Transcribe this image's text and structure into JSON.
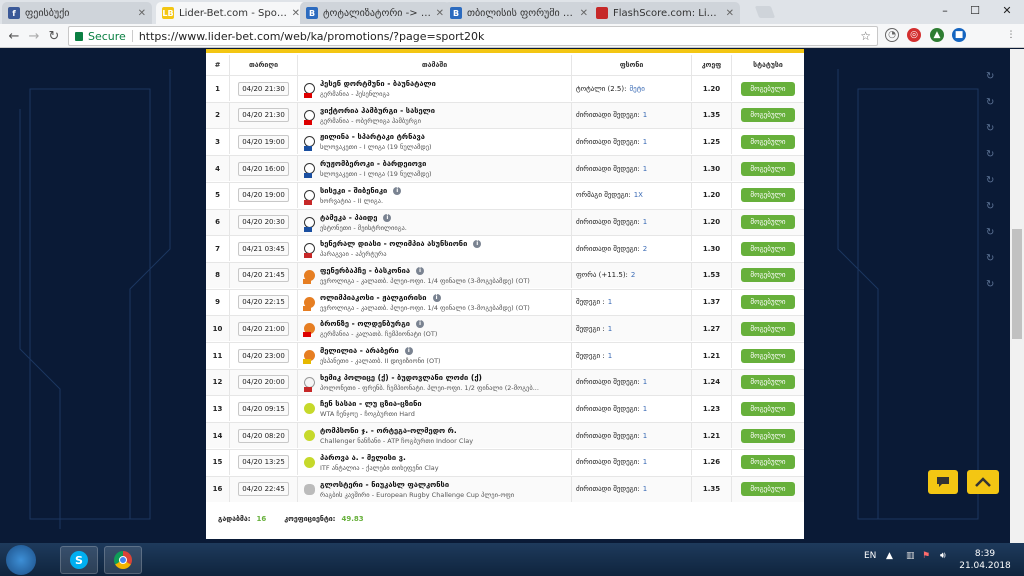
{
  "browser": {
    "tabs": [
      {
        "title": "ფეისბუქი",
        "favicon_color": "#3b5998",
        "favicon_char": "f",
        "active": false
      },
      {
        "title": "Lider-Bet.com - Sports a",
        "favicon_color": "#f3c613",
        "favicon_char": "LB",
        "active": true
      },
      {
        "title": "ტოტალიზატორი -> თბ",
        "favicon_color": "#2c6bbf",
        "favicon_char": "B",
        "active": false
      },
      {
        "title": "თბილისის ფორუმი - Pr",
        "favicon_color": "#2c6bbf",
        "favicon_char": "B",
        "active": false
      },
      {
        "title": "FlashScore.com: Live Foo",
        "favicon_color": "#c62828",
        "favicon_char": "",
        "active": false
      }
    ],
    "secure_label": "Secure",
    "url": "https://www.lider-bet.com/web/ka/promotions/?page=sport20k"
  },
  "table": {
    "headers": [
      "#",
      "თარიღი",
      "თამაში",
      "ფსონი",
      "კოეფ",
      "სტატუსი"
    ],
    "rows": [
      {
        "num": "1",
        "date": "04/20 21:30",
        "match": "ჰესენ დორტმუნი - ბაუნატალი",
        "league": "გერმანია - ჰესენლიგა",
        "bet": "ტოტალი (2.5):",
        "sel": "მეტი",
        "coef": "1.20",
        "status": "მოგებული",
        "icon": "ball",
        "flag": "#d00",
        "info": false
      },
      {
        "num": "2",
        "date": "04/20 21:30",
        "match": "ვიქტორია ჰამბურგი - სასელი",
        "league": "გერმანია - ობერლიგა ჰამბურგი",
        "bet": "ძირითადი შედეგი:",
        "sel": "1",
        "coef": "1.35",
        "status": "მოგებული",
        "icon": "ball",
        "flag": "#d00",
        "info": false
      },
      {
        "num": "3",
        "date": "04/20 19:00",
        "match": "ჟილინა - სპარტაკი ტრნავა",
        "league": "სლოვაკეთი - I ლიგა (19 ნულამდე)",
        "bet": "ძირითადი შედეგი:",
        "sel": "1",
        "coef": "1.25",
        "status": "მოგებული",
        "icon": "ball",
        "flag": "#1a4fa0",
        "info": false
      },
      {
        "num": "4",
        "date": "04/20 16:00",
        "match": "რუჟომბეროკი - ბარდეიოვი",
        "league": "სლოვაკეთი - I ლიგა (19 ნულამდე)",
        "bet": "ძირითადი შედეგი:",
        "sel": "1",
        "coef": "1.30",
        "status": "მოგებული",
        "icon": "ball",
        "flag": "#1a4fa0",
        "info": false
      },
      {
        "num": "5",
        "date": "04/20 19:00",
        "match": "სისეკი - შიბენიკი",
        "league": "ხორვატია - II ლიგა.",
        "bet": "ორმაგი შედეგი:",
        "sel": "1X",
        "coef": "1.20",
        "status": "მოგებული",
        "icon": "ball",
        "flag": "#c62828",
        "info": true
      },
      {
        "num": "6",
        "date": "04/20 20:30",
        "match": "ტამეკა - პაიდე",
        "league": "ესტონეთი - მეისტრილიიგა.",
        "bet": "ძირითადი შედეგი:",
        "sel": "1",
        "coef": "1.20",
        "status": "მოგებული",
        "icon": "ball",
        "flag": "#1a4fa0",
        "info": true
      },
      {
        "num": "7",
        "date": "04/21 03:45",
        "match": "ხენერალ დიასი - ოლიმპია ასუნსიონი",
        "league": "პარაგვაი - აპერტურა",
        "bet": "ძირითადი შედეგი:",
        "sel": "2",
        "coef": "1.30",
        "status": "მოგებული",
        "icon": "ball",
        "flag": "#c62828",
        "info": true
      },
      {
        "num": "8",
        "date": "04/20 21:45",
        "match": "ფენერბაჰჩე - ბასკონია",
        "league": "ევროლიგა - კალათბ. პლეი-ოფი. 1/4 ფინალი (3-მოგებამდე) (OT)",
        "bet": "ფორა (+11.5):",
        "sel": "2",
        "coef": "1.53",
        "status": "მოგებული",
        "icon": "basket",
        "flag": "#e67e22",
        "info": true
      },
      {
        "num": "9",
        "date": "04/20 22:15",
        "match": "ოლიმპიაკოსი - ჟალგირისი",
        "league": "ევროლიგა - კალათბ. პლეი-ოფი. 1/4 ფინალი (3-მოგებამდე) (OT)",
        "bet": "შედეგი :",
        "sel": "1",
        "coef": "1.37",
        "status": "მოგებული",
        "icon": "basket",
        "flag": "#e67e22",
        "info": true
      },
      {
        "num": "10",
        "date": "04/20 21:00",
        "match": "ბრონზე - ოლდენბურგი",
        "league": "გერმანია - კალათბ. ჩემპიონატი (OT)",
        "bet": "შედეგი :",
        "sel": "1",
        "coef": "1.27",
        "status": "მოგებული",
        "icon": "basket",
        "flag": "#d00",
        "info": true
      },
      {
        "num": "11",
        "date": "04/20 23:00",
        "match": "მელილია - არაბერი",
        "league": "ესპანეთი - კალათბ. II დივიზიონი (OT)",
        "bet": "შედეგი :",
        "sel": "1",
        "coef": "1.21",
        "status": "მოგებული",
        "icon": "basket",
        "flag": "#e6b800",
        "info": true
      },
      {
        "num": "12",
        "date": "04/20 20:00",
        "match": "ხემიკ პოლიცე (ქ) - ბუდოვლანი ლოძი (ქ)",
        "league": "პოლონეთი - ფრენბ. ჩემპიონატი. პლეი-ოფი. 1/2 ფინალი (2-მოგებ...",
        "bet": "ძირითადი შედეგი:",
        "sel": "1",
        "coef": "1.24",
        "status": "მოგებული",
        "icon": "volley",
        "flag": "#c62828",
        "info": false
      },
      {
        "num": "13",
        "date": "04/20 09:15",
        "match": "ჩენ სასაი - ლუ ცზია-ცზინი",
        "league": "WTA ჩენჯოუ - ჩოგბურთი Hard",
        "bet": "ძირითადი შედეგი:",
        "sel": "1",
        "coef": "1.23",
        "status": "მოგებული",
        "icon": "tennis",
        "flag": "",
        "info": false
      },
      {
        "num": "14",
        "date": "04/20 08:20",
        "match": "ტომპსონი ჯ. - ორტეგა-ოლმედო რ.",
        "league": "Challenger ნანჩანი - ATP ჩოგბურთი Indoor Clay",
        "bet": "ძირითადი შედეგი:",
        "sel": "1",
        "coef": "1.21",
        "status": "მოგებული",
        "icon": "tennis",
        "flag": "",
        "info": false
      },
      {
        "num": "15",
        "date": "04/20 13:25",
        "match": "პაროვა ა. - მელისი ვ.",
        "league": "ITF ანტალია - ქალები თიხეფენი Clay",
        "bet": "ძირითადი შედეგი:",
        "sel": "1",
        "coef": "1.26",
        "status": "მოგებული",
        "icon": "tennis",
        "flag": "",
        "info": false
      },
      {
        "num": "16",
        "date": "04/20 22:45",
        "match": "გლოსტერი - ნიუკასლ ფალკონსი",
        "league": "რაგბის კავშირი - European Rugby Challenge Cup პლეი-ოფი",
        "bet": "ძირითადი შედეგი:",
        "sel": "1",
        "coef": "1.35",
        "status": "მოგებული",
        "icon": "rugby",
        "flag": "",
        "info": false
      }
    ]
  },
  "summary": {
    "count_label": "გადაბმა:",
    "count_value": "16",
    "coef_label": "კოეფიციენტი:",
    "coef_value": "49.83"
  },
  "taskbar": {
    "lang": "EN",
    "time": "8:39",
    "date": "21.04.2018"
  }
}
